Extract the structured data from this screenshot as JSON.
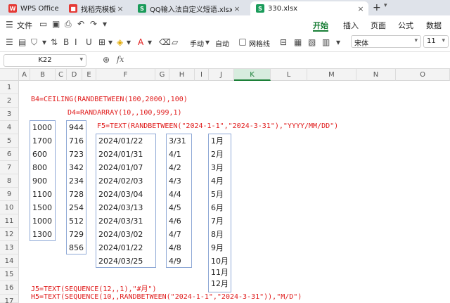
{
  "tabs": [
    {
      "label": "WPS Office",
      "icon": "W",
      "color": "#e53935"
    },
    {
      "label": "找稻壳模板",
      "icon": "■",
      "color": "#e53935"
    },
    {
      "label": "QQ输入法自定义短语.xlsx",
      "icon": "S",
      "color": "#1a9b5a"
    },
    {
      "label": "330.xlsx",
      "icon": "S",
      "color": "#1a9b5a"
    }
  ],
  "menu": {
    "file": "文件",
    "ribbon_tabs": [
      "开始",
      "插入",
      "页面",
      "公式",
      "数据"
    ]
  },
  "toolbar": {
    "handwriting": "手动",
    "auto": "自动",
    "gridlines": "网格线",
    "font": "宋体",
    "size": "11"
  },
  "formula_bar": {
    "name_box": "K22",
    "fx": "fx"
  },
  "sheet": {
    "columns": [
      "A",
      "B",
      "C",
      "D",
      "E",
      "F",
      "G",
      "H",
      "I",
      "J",
      "K",
      "L",
      "M",
      "N",
      "O"
    ],
    "selected_column": "K",
    "rows": [
      "1",
      "2",
      "3",
      "4",
      "5",
      "6",
      "7",
      "8",
      "9",
      "10",
      "11",
      "12",
      "13",
      "14",
      "15",
      "16",
      "17"
    ],
    "formulas": {
      "b4": "B4=CEILING(RANDBETWEEN(100,2000),100)",
      "d4": "D4=RANDARRAY(10,,100,999,1)",
      "f5": "F5=TEXT(RANDBETWEEN(\"2024-1-1\",\"2024-3-31\"),\"YYYY/MM/DD\")",
      "j5": "J5=TEXT(SEQUENCE(12,,1),\"#月\")",
      "h5": "H5=TEXT(SEQUENCE(10,,RANDBETWEEN(\"2024-1-1\",\"2024-3-31\")),\"M/D\")"
    },
    "col_b": [
      "1000",
      "1700",
      "600",
      "800",
      "900",
      "1100",
      "1500",
      "1000",
      "1300"
    ],
    "col_d": [
      "944",
      "716",
      "723",
      "342",
      "234",
      "728",
      "254",
      "512",
      "729",
      "856"
    ],
    "col_f": [
      "2024/01/22",
      "2024/01/31",
      "2024/01/07",
      "2024/02/03",
      "2024/03/04",
      "2024/03/13",
      "2024/03/31",
      "2024/03/02",
      "2024/01/22",
      "2024/03/25"
    ],
    "col_h": [
      "3/31",
      "4/1",
      "4/2",
      "4/3",
      "4/4",
      "4/5",
      "4/6",
      "4/7",
      "4/8",
      "4/9"
    ],
    "col_j": [
      "1月",
      "2月",
      "3月",
      "4月",
      "5月",
      "6月",
      "7月",
      "8月",
      "9月",
      "10月",
      "11月",
      "12月"
    ]
  }
}
